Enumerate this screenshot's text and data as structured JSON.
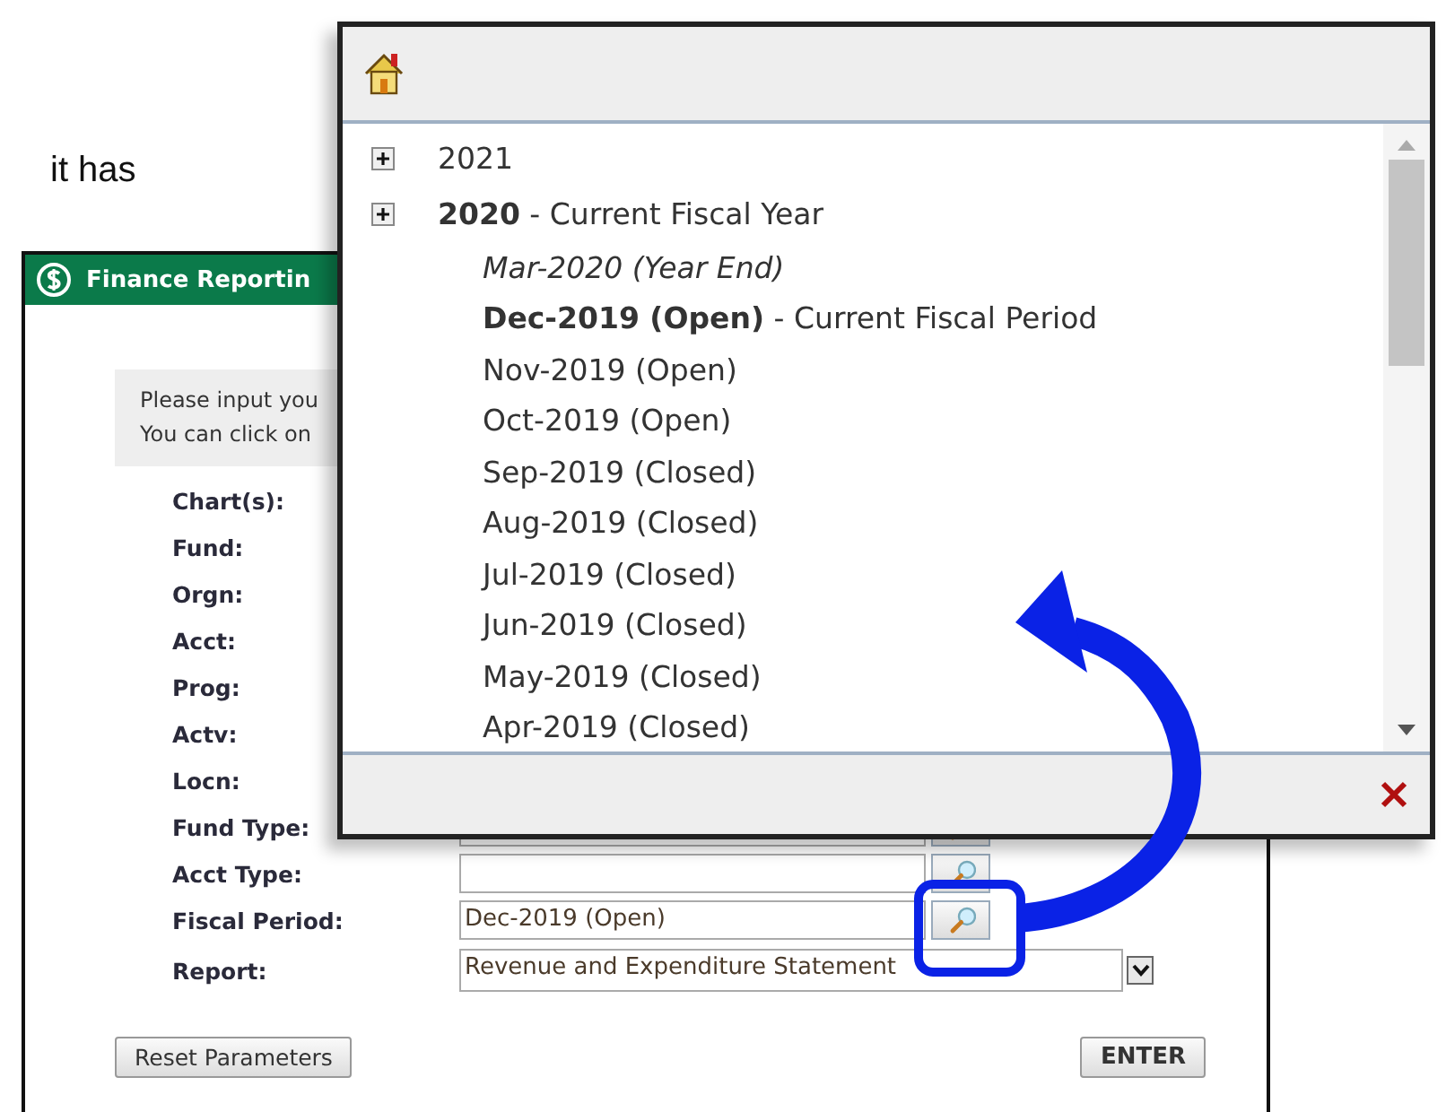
{
  "caption": "it has",
  "form_window": {
    "title": "Finance Reportin",
    "instructions": [
      "Please input you",
      "You can click on"
    ],
    "fields": [
      {
        "label": "Chart(s):"
      },
      {
        "label": "Fund:"
      },
      {
        "label": "Orgn:"
      },
      {
        "label": "Acct:"
      },
      {
        "label": "Prog:"
      },
      {
        "label": "Actv:"
      },
      {
        "label": "Locn:"
      },
      {
        "label": "Fund Type:",
        "kind": "lookup"
      },
      {
        "label": "Acct Type:",
        "kind": "lookup"
      },
      {
        "label": "Fiscal Period:",
        "kind": "lookup",
        "value": "Dec-2019 (Open)"
      },
      {
        "label": "Report:",
        "kind": "select",
        "value": "Revenue and Expenditure Statement"
      }
    ],
    "buttons": [
      {
        "label": "Reset Parameters",
        "kind": "reset"
      },
      {
        "label": "ENTER",
        "kind": "submit"
      }
    ]
  },
  "period_popup": {
    "tree": [
      {
        "label": "2021",
        "kind": "year"
      },
      {
        "label": "**2020** - Current Fiscal Year",
        "kind": "year",
        "children": [
          {
            "label": "Mar-2020 (Year End)",
            "kind": "year_end"
          },
          {
            "label": "**Dec-2019 (Open)** - Current Fiscal Period",
            "kind": "period"
          },
          {
            "label": "Nov-2019 (Open)",
            "kind": "period"
          },
          {
            "label": "Oct-2019 (Open)",
            "kind": "period"
          },
          {
            "label": "Sep-2019 (Closed)",
            "kind": "period"
          },
          {
            "label": "Aug-2019 (Closed)",
            "kind": "period"
          },
          {
            "label": "Jul-2019 (Closed)",
            "kind": "period"
          },
          {
            "label": "Jun-2019 (Closed)",
            "kind": "period"
          },
          {
            "label": "May-2019 (Closed)",
            "kind": "period"
          },
          {
            "label": "Apr-2019 (Closed)",
            "kind": "period"
          }
        ]
      }
    ]
  }
}
